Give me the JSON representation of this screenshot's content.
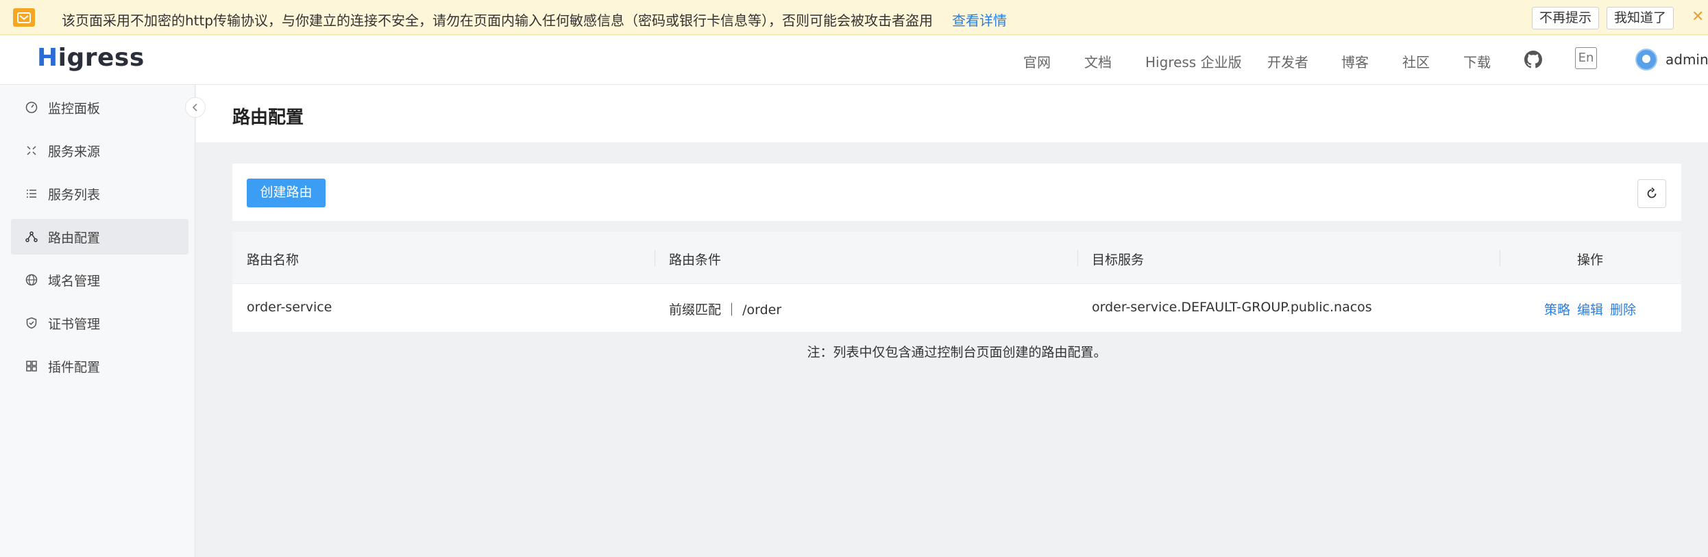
{
  "banner": {
    "message": "该页面采用不加密的http传输协议，与你建立的连接不安全，请勿在页面内输入任何敏感信息（密码或银行卡信息等），否则可能会被攻击者盗用",
    "detail_link": "查看详情",
    "dont_show_button": "不再提示",
    "got_it_button": "我知道了",
    "close_symbol": "✕"
  },
  "header": {
    "logo_h": "H",
    "logo_rest": "igress",
    "nav": [
      "官网",
      "文档",
      "Higress 企业版",
      "开发者",
      "博客",
      "社区",
      "下载"
    ],
    "lang": "En",
    "user": "admin"
  },
  "sidebar": {
    "items": [
      {
        "label": "监控面板",
        "icon": "dashboard-icon"
      },
      {
        "label": "服务来源",
        "icon": "service-source-icon"
      },
      {
        "label": "服务列表",
        "icon": "list-icon"
      },
      {
        "label": "路由配置",
        "icon": "route-icon"
      },
      {
        "label": "域名管理",
        "icon": "globe-icon"
      },
      {
        "label": "证书管理",
        "icon": "shield-icon"
      },
      {
        "label": "插件配置",
        "icon": "plugin-icon"
      }
    ],
    "active_index": 3
  },
  "page": {
    "title": "路由配置",
    "create_button": "创建路由"
  },
  "table": {
    "columns": [
      "路由名称",
      "路由条件",
      "目标服务",
      "操作"
    ],
    "rows": [
      {
        "name": "order-service",
        "condition": "前缀匹配 ｜ /order",
        "target": "order-service.DEFAULT-GROUP.public.nacos",
        "actions": [
          "策略",
          "编辑",
          "删除"
        ]
      }
    ]
  },
  "note": "注：列表中仅包含通过控制台页面创建的路由配置。",
  "colors": {
    "primary": "#3c9df5",
    "link": "#2a7de1",
    "banner_bg": "#fdf6d8",
    "warning": "#f5a623"
  }
}
